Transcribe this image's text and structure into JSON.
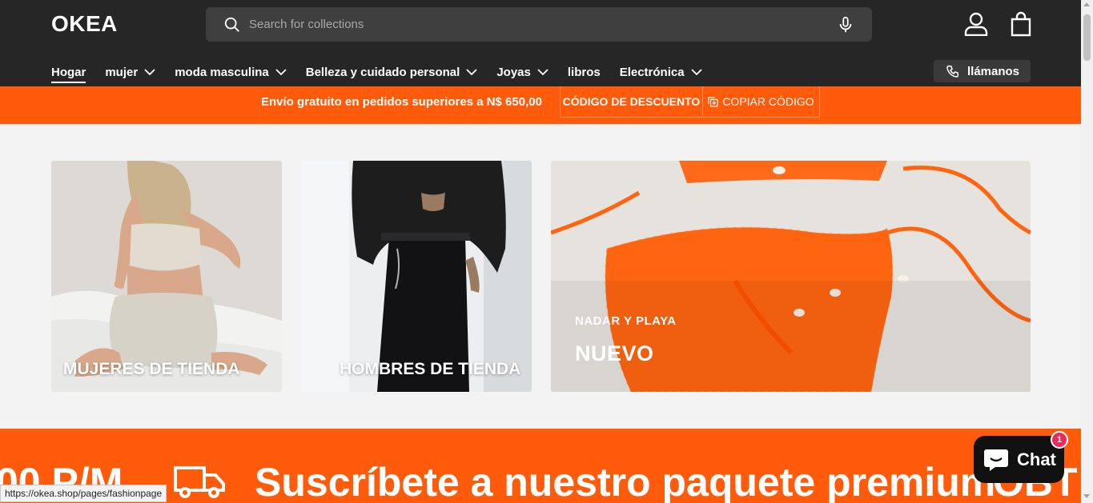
{
  "header": {
    "logo": "OKEA",
    "search_placeholder": "Search for collections",
    "call_label": "llámanos"
  },
  "nav": {
    "items": [
      {
        "label": "Hogar",
        "has_dropdown": false,
        "active": true
      },
      {
        "label": "mujer",
        "has_dropdown": true
      },
      {
        "label": "moda masculina",
        "has_dropdown": true
      },
      {
        "label": "Belleza y cuidado personal",
        "has_dropdown": true
      },
      {
        "label": "Joyas",
        "has_dropdown": true
      },
      {
        "label": "libros",
        "has_dropdown": false
      },
      {
        "label": "Electrónica",
        "has_dropdown": true
      }
    ]
  },
  "promo": {
    "text": "Envío gratuito en pedidos superiores a N$ 650,00",
    "code_label": "CÓDIGO DE DESCUENTO",
    "copy_label": "COPIAR CÓDIGO"
  },
  "cards": {
    "women": {
      "label": "MUJERES DE TIENDA"
    },
    "men": {
      "label": "HOMBRES DE TIENDA"
    },
    "swim": {
      "subtitle": "NADAR Y PLAYA",
      "title": "NUEVO"
    }
  },
  "banner": {
    "left_text": "00 P/M",
    "main_text": "Suscríbete a nuestro paquete premium",
    "right_text": "OBT"
  },
  "chat": {
    "label": "Chat",
    "badge": "1"
  },
  "status_url": "https://okea.shop/pages/fashionpage",
  "colors": {
    "accent": "#ff5b0b",
    "header_bg": "#262626",
    "badge": "#ea2a5b"
  }
}
